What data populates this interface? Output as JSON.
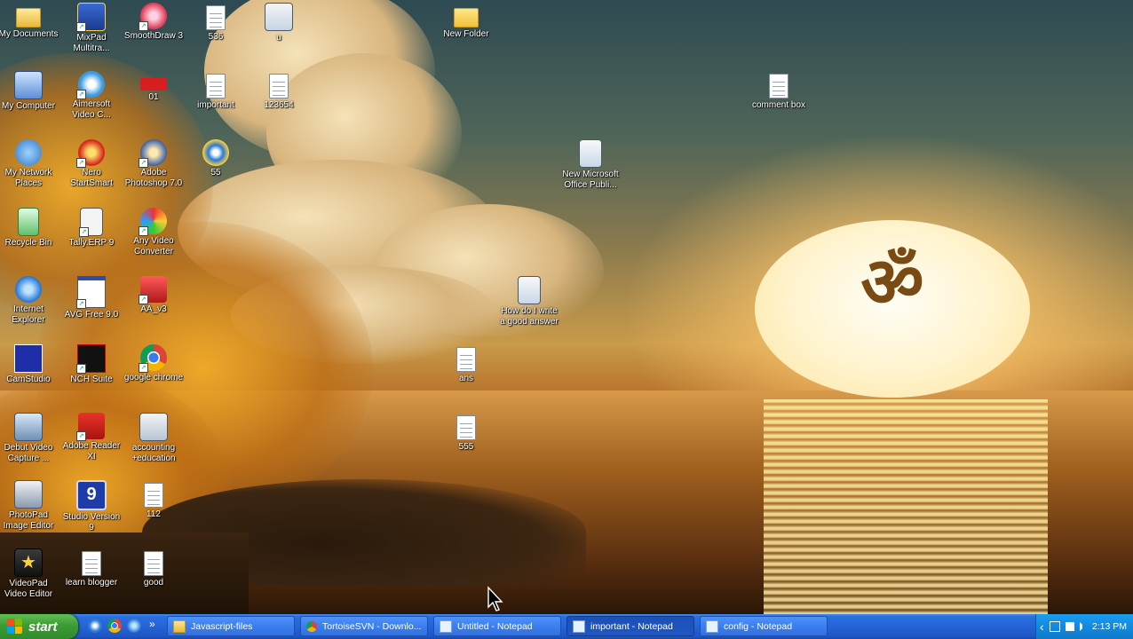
{
  "desktop": {
    "icons": {
      "my_documents": "My Documents",
      "mixpad": "MixPad\nMultitra...",
      "smoothdraw": "SmoothDraw 3",
      "f536": "536",
      "u": "u",
      "new_folder": "New Folder",
      "my_computer": "My Computer",
      "aimersoft": "Aimersoft\nVideo C...",
      "f01": "01",
      "important": "important",
      "f123654": "123654",
      "comment_box": "comment box",
      "my_network_places": "My Network\nPlaces",
      "nero": "Nero\nStartSmart",
      "photoshop": "Adobe\nPhotoshop 7.0",
      "f55": "55",
      "new_ms_office": "New Microsoft\nOffice Publi...",
      "recycle_bin": "Recycle Bin",
      "tally": "Tally.ERP 9",
      "any_video": "Any Video\nConverter",
      "internet_explorer": "Internet\nExplorer",
      "avg": "AVG Free 9.0",
      "aa_v3": "AA_v3",
      "how_do_i": "How do I write\na good answer",
      "camstudio": "CamStudio",
      "nch": "NCH Suite",
      "chrome": "google chrome",
      "ans": "ans",
      "debut": "Debut Video\nCapture ...",
      "adobe_reader": "Adobe Reader\nXI",
      "accounting": "accounting\n+education",
      "f555": "555",
      "photopad": "PhotoPad\nImage Editor",
      "studio": "Studio Version\n9",
      "f112": "112",
      "videopad": "VideoPad\nVideo Editor",
      "learn_blogger": "learn blogger",
      "good": "good"
    },
    "wallpaper_symbol": "ॐ"
  },
  "taskbar": {
    "start_label": "start",
    "chevron": "»",
    "tasks": [
      {
        "label": "Javascript-files"
      },
      {
        "label": "TortoiseSVN - Downlo..."
      },
      {
        "label": "Untitled - Notepad"
      },
      {
        "label": "important - Notepad"
      },
      {
        "label": "config - Notepad"
      }
    ],
    "tray_chevron": "‹",
    "clock": "2:13 PM"
  },
  "colors": {
    "taskbar_blue": "#2563d6",
    "start_green": "#3c9b35",
    "tray_blue": "#128ae0"
  }
}
